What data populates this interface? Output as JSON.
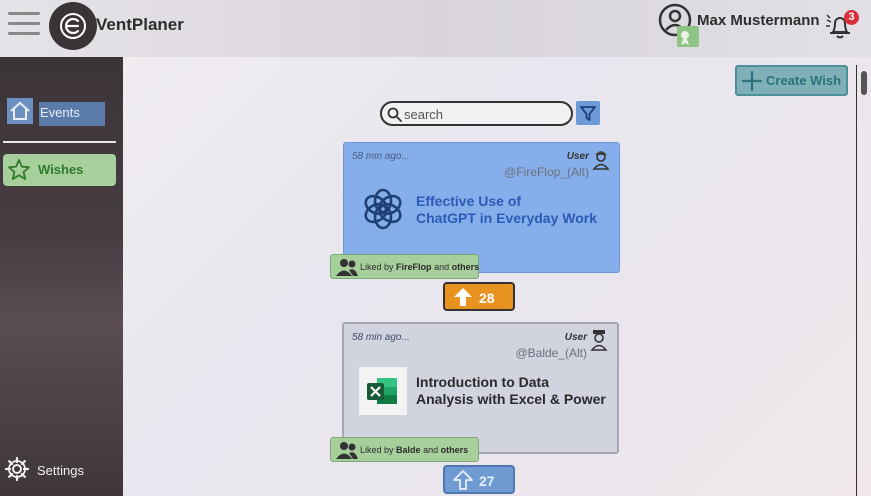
{
  "header": {
    "app_title": "VentPlaner",
    "user_name": "Max Mustermann",
    "notification_count": "3"
  },
  "sidebar": {
    "items": [
      {
        "label": "Events",
        "icon": "home-icon"
      },
      {
        "label": "Wishes",
        "icon": "star-icon"
      }
    ],
    "settings_label": "Settings"
  },
  "toolbar": {
    "create_wish_label": "Create Wish",
    "search_placeholder": "search"
  },
  "wishes": [
    {
      "time": "58 min ago...",
      "role": "User",
      "handle": "@FireFlop_(Alt)",
      "title_line1": "Effective Use of",
      "title_line2": "ChatGPT in Everyday Work",
      "liked_prefix": "Liked by",
      "liked_user": "FireFlop",
      "liked_mid": "and",
      "liked_others": "others",
      "votes": "28",
      "thumbnail": "openai-logo-icon"
    },
    {
      "time": "58 min ago...",
      "role": "User",
      "handle": "@Balde_(Alt)",
      "title_line1": "Introduction to Data",
      "title_line2": "Analysis with Excel & Power",
      "liked_prefix": "Liked by",
      "liked_user": "Balde",
      "liked_mid": "and",
      "liked_others": "others",
      "votes": "27",
      "thumbnail": "excel-logo-icon"
    }
  ],
  "colors": {
    "accent_blue": "#86aeea",
    "liked_green": "#a7cf9c",
    "vote_orange": "#e8921f",
    "badge_red": "#d8303a"
  }
}
